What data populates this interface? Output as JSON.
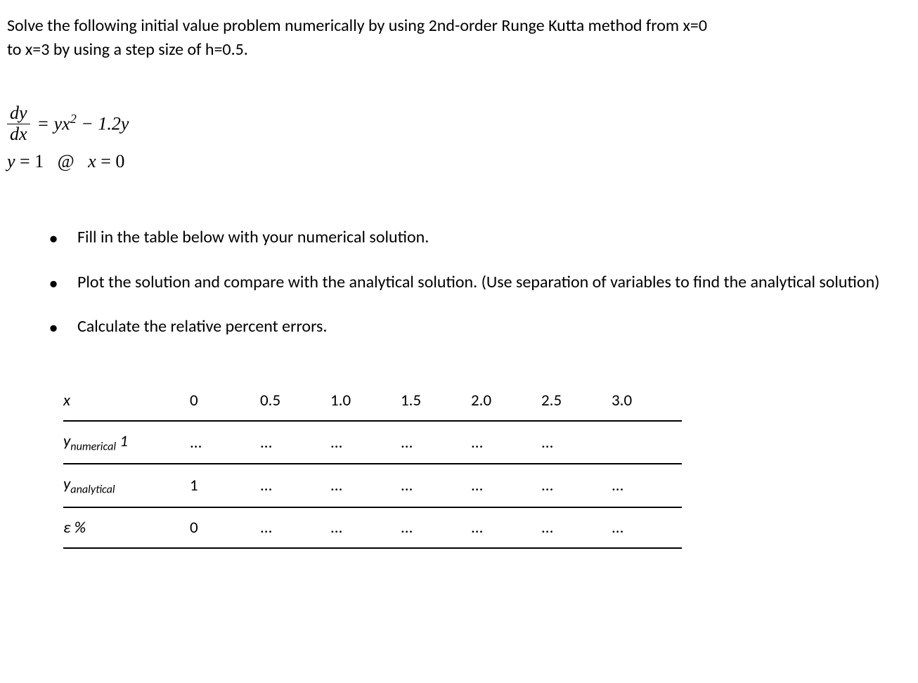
{
  "problem": {
    "line1": "Solve the following initial value problem numerically by using 2nd-order Runge Kutta method from x=0",
    "line2": "to x=3 by using a step size of h=0.5."
  },
  "equation": {
    "frac_num": "dy",
    "frac_den": "dx",
    "rhs": "= yx² − 1.2y",
    "ic": "y = 1    @    x = 0"
  },
  "bullets": [
    "Fill in the table below with your numerical solution.",
    "Plot the solution and compare with the analytical solution. (Use separation of variables to find the analytical solution)",
    "Calculate the relative percent errors."
  ],
  "chart_data": {
    "type": "table",
    "row_labels": {
      "x": "x",
      "ynum_base": "y",
      "ynum_sub": "numerical",
      "ynum_after": " 1",
      "yana_base": "y",
      "yana_sub": "analytical",
      "eps": "ε %"
    },
    "columns": [
      "0",
      "0.5",
      "1.0",
      "1.5",
      "2.0",
      "2.5",
      "3.0"
    ],
    "rows": {
      "x": [
        "0",
        "0.5",
        "1.0",
        "1.5",
        "2.0",
        "2.5",
        "3.0"
      ],
      "ynumerical": [
        "...",
        "...",
        "...",
        "...",
        "...",
        "...",
        ""
      ],
      "yanalytical": [
        "1",
        "...",
        "...",
        "...",
        "...",
        "...",
        "..."
      ],
      "epsilon": [
        "0",
        "...",
        "...",
        "...",
        "...",
        "...",
        "..."
      ]
    }
  }
}
